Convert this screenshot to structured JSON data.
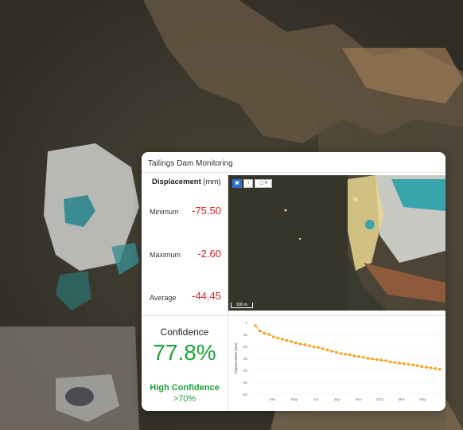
{
  "card": {
    "title": "Tailings Dam Monitoring"
  },
  "displacement": {
    "title": "Displacement",
    "unit": "(mm)",
    "stats": [
      {
        "label": "Minimum",
        "value": "-75.50"
      },
      {
        "label": "Maximum",
        "value": "-2.60"
      },
      {
        "label": "Average",
        "value": "-44.45"
      }
    ]
  },
  "confidence": {
    "title": "Confidence",
    "value": "77.8%",
    "level": "High Confidence",
    "threshold": ">70%"
  },
  "map": {
    "tools": [
      "layers-icon",
      "expand-icon",
      "basemap-dropdown-icon"
    ],
    "scale_label": "100 m"
  },
  "colors": {
    "negative": "#d62424",
    "positive": "#1ea33a",
    "series": "#f5a623",
    "accent": "#2b6fd1"
  },
  "chart_data": {
    "type": "scatter",
    "ylabel": "Displacement (mm)",
    "ylim": [
      -60,
      0
    ],
    "yticks": [
      "0",
      "-10",
      "-20",
      "-30",
      "-40",
      "-50",
      "-60"
    ],
    "xticks": [
      "Mar",
      "May",
      "Jul",
      "Sep",
      "Nov",
      "2021",
      "Mar",
      "May"
    ],
    "y": [
      -2.6,
      -7,
      -9,
      -10,
      -12,
      -13,
      -14,
      -15,
      -16,
      -17,
      -18,
      -18.5,
      -19.5,
      -20.5,
      -21,
      -22,
      -23,
      -24,
      -25,
      -26,
      -26.5,
      -27,
      -28,
      -28.5,
      -29,
      -30,
      -30.5,
      -31,
      -31.5,
      -32,
      -33,
      -33.5,
      -34,
      -34.5,
      -35,
      -35.5,
      -36,
      -37,
      -37.5,
      -38,
      -38.5,
      -39
    ]
  }
}
